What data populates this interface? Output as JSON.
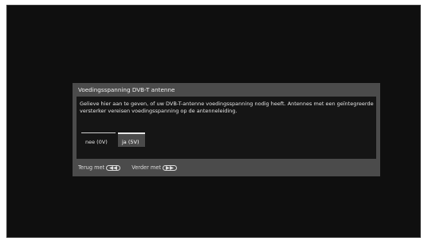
{
  "dialog": {
    "title": "Voedingsspanning DVB-T antenne",
    "message": "Gelieve hier aan te geven, of uw DVB-T-antenne voedingsspanning nodig heeft. Antennes met een geïntegreerde versterker vereisen voedingsspanning op de antenneleiding.",
    "options": [
      {
        "label": "nee (0V)",
        "selected": false
      },
      {
        "label": "ja (5V)",
        "selected": true
      }
    ]
  },
  "footer": {
    "back_label": "Terug met",
    "back_icon": "rewind-icon",
    "next_label": "Verder met",
    "next_icon": "fast-forward-icon"
  },
  "colors": {
    "screen_background": "#0f0f0f",
    "dialog_frame": "#4b4b4b",
    "dialog_body": "#151515",
    "selected_option": "#4a4a4a"
  }
}
